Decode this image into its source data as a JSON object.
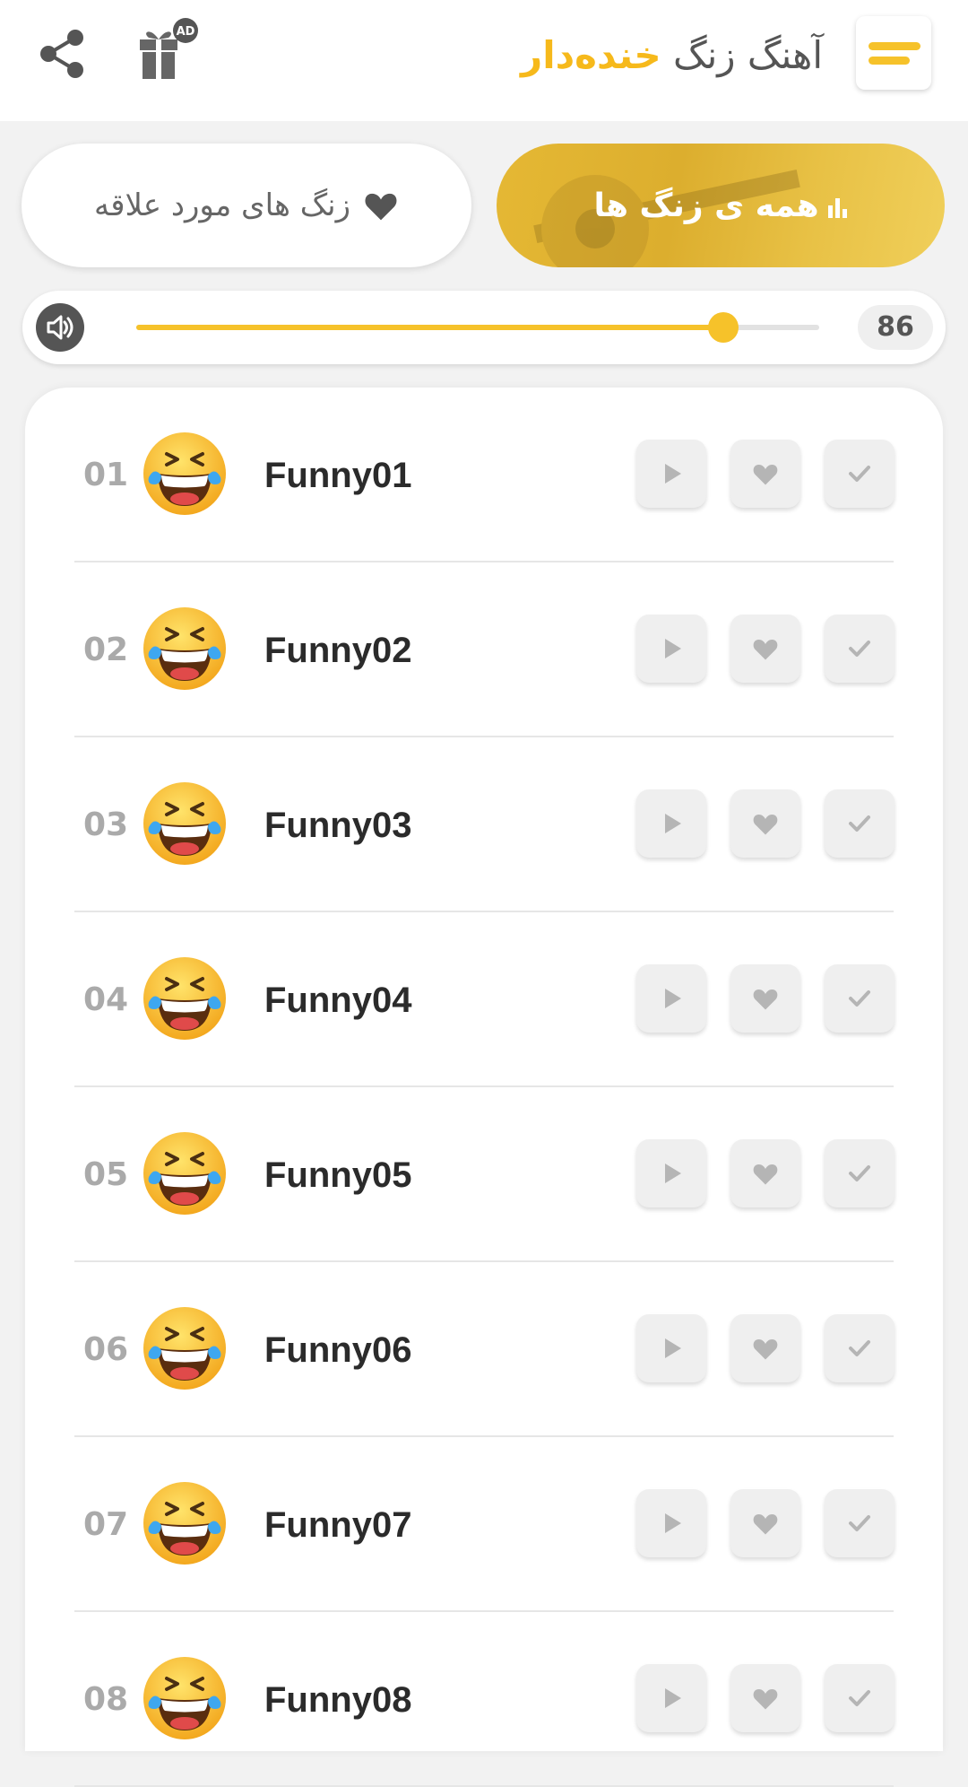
{
  "header": {
    "title_prefix": "آهنگ زنگ",
    "title_highlight": "خنده‌دار",
    "gift_badge": "AD",
    "accent": "#f6c22a"
  },
  "tabs": [
    {
      "label": "همه ی زنگ ها",
      "icon": "bar-chart-icon",
      "active": true
    },
    {
      "label": "زنگ های مورد علاقه",
      "icon": "heart-icon",
      "active": false
    }
  ],
  "volume": {
    "value": "86",
    "level": 0.86
  },
  "ringtones": [
    {
      "num": "01",
      "name": "Funny01"
    },
    {
      "num": "02",
      "name": "Funny02"
    },
    {
      "num": "03",
      "name": "Funny03"
    },
    {
      "num": "04",
      "name": "Funny04"
    },
    {
      "num": "05",
      "name": "Funny05"
    },
    {
      "num": "06",
      "name": "Funny06"
    },
    {
      "num": "07",
      "name": "Funny07"
    },
    {
      "num": "08",
      "name": "Funny08"
    }
  ]
}
